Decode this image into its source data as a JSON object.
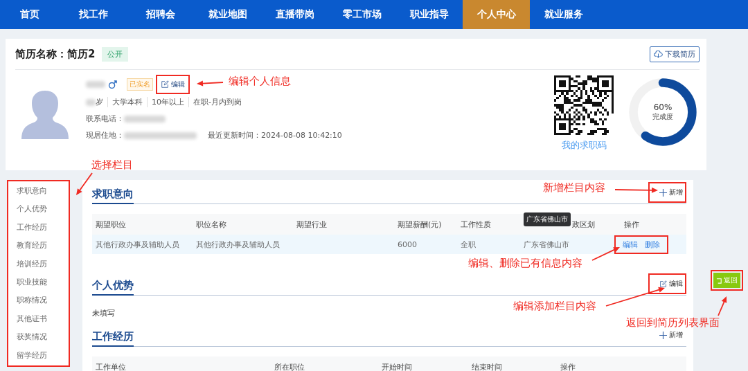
{
  "nav": {
    "tabs": [
      {
        "label": "首页",
        "selected": false
      },
      {
        "label": "找工作",
        "selected": false
      },
      {
        "label": "招聘会",
        "selected": false
      },
      {
        "label": "就业地图",
        "selected": false
      },
      {
        "label": "直播带岗",
        "selected": false
      },
      {
        "label": "零工市场",
        "selected": false
      },
      {
        "label": "职业指导",
        "selected": false
      },
      {
        "label": "个人中心",
        "selected": true
      },
      {
        "label": "就业服务",
        "selected": false
      }
    ]
  },
  "resume": {
    "title": "简历名称：简历2",
    "visibility": "公开",
    "download_button": "下载简历",
    "profile": {
      "verified_badge": "已实名",
      "edit_button": {
        "label": "编辑",
        "highlighted": true
      },
      "age_unit": "岁",
      "details": [
        "大学本科",
        "10年以上",
        "在职-月内到岗"
      ],
      "phone_label": "联系电话：",
      "address_label": "现居住地：",
      "updated": "最近更新时间：2024-08-08 10:42:10"
    },
    "qr_caption": "我的求职码",
    "completion": {
      "level": 0.6,
      "percent": "60%",
      "label": "完成度"
    }
  },
  "sidebar": {
    "highlighted": true,
    "items": [
      "求职意向",
      "个人优势",
      "工作经历",
      "教育经历",
      "培训经历",
      "职业技能",
      "职称情况",
      "其他证书",
      "获奖情况",
      "留学经历"
    ]
  },
  "sections": [
    {
      "kind": "table",
      "title": "求职意向",
      "action": {
        "kind": "add",
        "label": "新增",
        "highlighted": true
      },
      "table": {
        "columns": [
          "期望职位",
          "职位名称",
          "期望行业",
          "期望薪酬(元)",
          "工作性质",
          "政区划",
          "操作"
        ],
        "tooltip": "广东省佛山市",
        "rows": [
          {
            "cells": [
              "其他行政办事及辅助人员",
              "其他行政办事及辅助人员",
              "",
              "6000",
              "全职",
              "广东省佛山市"
            ],
            "actions": [
              "编辑",
              "删除"
            ],
            "actions_highlighted": true
          }
        ]
      }
    },
    {
      "kind": "text",
      "title": "个人优势",
      "action": {
        "kind": "edit",
        "label": "编辑",
        "highlighted": true
      },
      "text": "未填写"
    },
    {
      "kind": "table",
      "title": "工作经历",
      "action": {
        "kind": "add",
        "label": "新增",
        "highlighted": false
      },
      "table": {
        "columns": [
          "工作单位",
          "所在职位",
          "开始时间",
          "结束时间",
          "操作"
        ]
      }
    }
  ],
  "return_button": {
    "label": "返回",
    "highlighted": true
  },
  "annotations": [
    "编辑个人信息",
    "选择栏目",
    "新增栏目内容",
    "编辑、删除已有信息内容",
    "编辑添加栏目内容",
    "返回到简历列表界面"
  ]
}
